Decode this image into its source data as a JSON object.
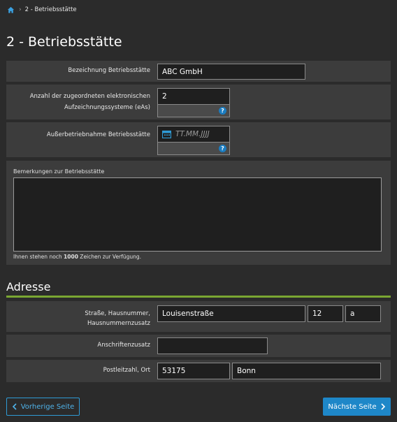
{
  "breadcrumb": {
    "home_icon": "home-icon",
    "current": "2 - Betriebsstätte"
  },
  "page": {
    "title": "2 - Betriebsstätte"
  },
  "form": {
    "bezeichnung": {
      "label": "Bezeichnung Betriebsstätte",
      "value": "ABC GmbH"
    },
    "anzahl": {
      "label_line1": "Anzahl der zugeordneten elektronischen",
      "label_line2": "Aufzeichnungssysteme (eAs)",
      "value": "2",
      "help": "?"
    },
    "ausserbetrieb": {
      "label": "Außerbetriebnahme Betriebsstätte",
      "placeholder": "TT.MM.JJJJ",
      "help": "?"
    },
    "bemerkungen": {
      "label": "Bemerkungen zur Betriebsstätte",
      "hint_before": "Ihnen stehen noch ",
      "hint_count": "1000",
      "hint_after": " Zeichen zur Verfügung."
    }
  },
  "address": {
    "heading": "Adresse",
    "strasse": {
      "label_line1": "Straße, Hausnummer,",
      "label_line2": "Hausnummernzusatz",
      "street": "Louisenstraße",
      "number": "12",
      "suffix": "a"
    },
    "anschrift": {
      "label": "Anschriftenzusatz",
      "value": ""
    },
    "ort": {
      "label": "Postleitzahl, Ort",
      "plz": "53175",
      "city": "Bonn"
    }
  },
  "nav": {
    "prev_label": "Vorherige Seite",
    "next_label": "Nächste Seite"
  },
  "colors": {
    "accent_blue": "#1e87c8",
    "green_rule": "#7aa632",
    "background": "#2b2b2b",
    "panel": "#3c3c3c"
  }
}
